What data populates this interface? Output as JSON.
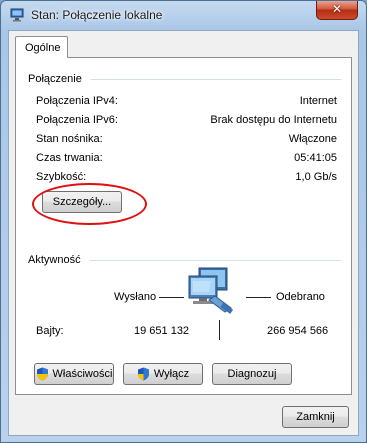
{
  "window": {
    "title": "Stan: Połączenie lokalne"
  },
  "tabs": [
    {
      "label": "Ogólne"
    }
  ],
  "connection": {
    "group_label": "Połączenie",
    "rows": [
      {
        "label": "Połączenia IPv4:",
        "value": "Internet"
      },
      {
        "label": "Połączenia IPv6:",
        "value": "Brak dostępu do Internetu"
      },
      {
        "label": "Stan nośnika:",
        "value": "Włączone"
      },
      {
        "label": "Czas trwania:",
        "value": "05:41:05"
      },
      {
        "label": "Szybkość:",
        "value": "1,0 Gb/s"
      }
    ],
    "details_button": "Szczegóły..."
  },
  "activity": {
    "group_label": "Aktywność",
    "sent_label": "Wysłano",
    "received_label": "Odebrano",
    "bytes_label": "Bajty:",
    "bytes_sent": "19 651 132",
    "bytes_received": "266 954 566"
  },
  "buttons": {
    "properties": "Właściwości",
    "disable": "Wyłącz",
    "diagnose": "Diagnozuj",
    "close": "Zamknij"
  },
  "icons": {
    "window": "network-status-icon",
    "shield": "uac-shield-icon",
    "network": "network-computers-icon"
  },
  "colors": {
    "highlight": "#e01010",
    "title_bar": "#a9c6e6"
  }
}
